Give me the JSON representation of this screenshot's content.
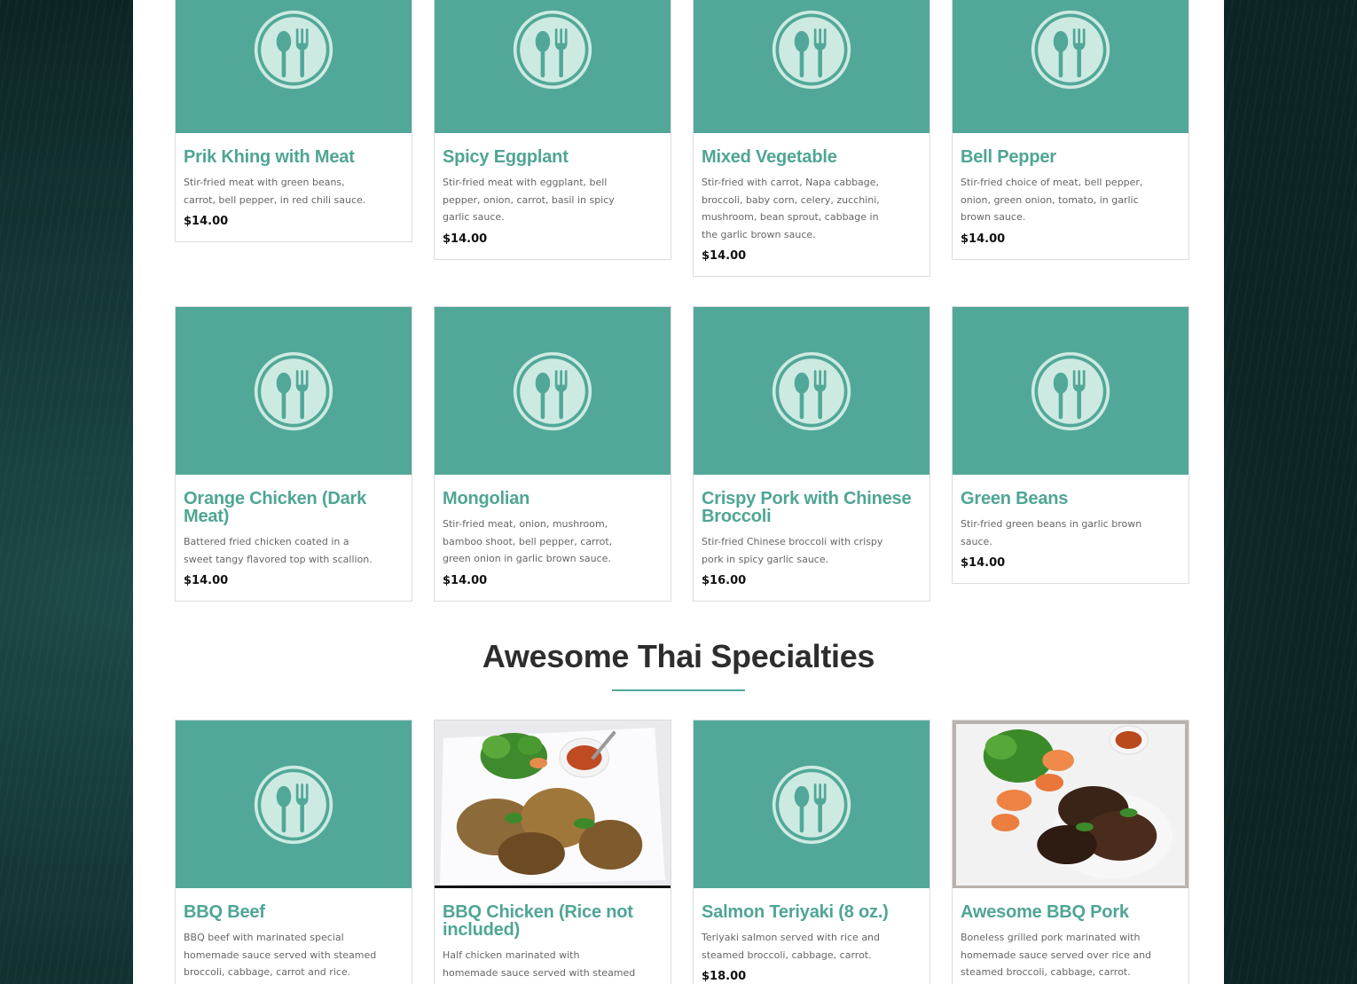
{
  "section_heading": "Awesome Thai Specialties",
  "colors": {
    "accent": "#4fa594",
    "placeholder_bg": "#52a898",
    "icon": "#cdeae2"
  },
  "placeholder_icon": "spoon-fork-icon",
  "cards": [
    {
      "title": "Prik Khing with Meat",
      "desc": "Stir-fried meat with green beans, carrot, bell pepper, in red chili sauce.",
      "price": "$14.00"
    },
    {
      "title": "Spicy Eggplant",
      "desc": "Stir-fried meat with eggplant, bell pepper, onion, carrot, basil in spicy garlic sauce.",
      "price": "$14.00"
    },
    {
      "title": "Mixed Vegetable",
      "desc": "Stir-fried with carrot, Napa cabbage, broccoli, baby corn, celery, zucchini, mushroom, bean sprout, cabbage in the garlic brown sauce.",
      "price": "$14.00"
    },
    {
      "title": "Bell Pepper",
      "desc": "Stir-fried choice of meat, bell pepper, onion, green onion, tomato, in garlic brown sauce.",
      "price": "$14.00"
    },
    {
      "title": "Orange Chicken (Dark Meat)",
      "desc": "Battered fried chicken coated in a sweet tangy flavored top with scallion.",
      "price": "$14.00"
    },
    {
      "title": "Mongolian",
      "desc": "Stir-fried meat, onion, mushroom, bamboo shoot, bell pepper, carrot, green onion in garlic brown sauce.",
      "price": "$14.00"
    },
    {
      "title": "Crispy Pork with Chinese Broccoli",
      "desc": "Stir-fried Chinese broccoli with crispy pork in spicy garlic sauce.",
      "price": "$16.00"
    },
    {
      "title": "Green Beans",
      "desc": "Stir-fried green beans in garlic brown sauce.",
      "price": "$14.00"
    },
    {
      "title": "BBQ Beef",
      "desc": "BBQ beef with marinated special homemade sauce served with steamed broccoli, cabbage, carrot and rice.",
      "price": ""
    },
    {
      "title": "BBQ Chicken (Rice not included)",
      "desc": "Half chicken marinated with homemade sauce served with steamed broccoli.",
      "price": ""
    },
    {
      "title": "Salmon Teriyaki (8 oz.)",
      "desc": "Teriyaki salmon served with rice and steamed broccoli, cabbage, carrot.",
      "price": "$18.00"
    },
    {
      "title": "Awesome BBQ Pork",
      "desc": "Boneless grilled pork marinated with homemade sauce served over rice and steamed broccoli, cabbage, carrot.",
      "price": ""
    }
  ]
}
